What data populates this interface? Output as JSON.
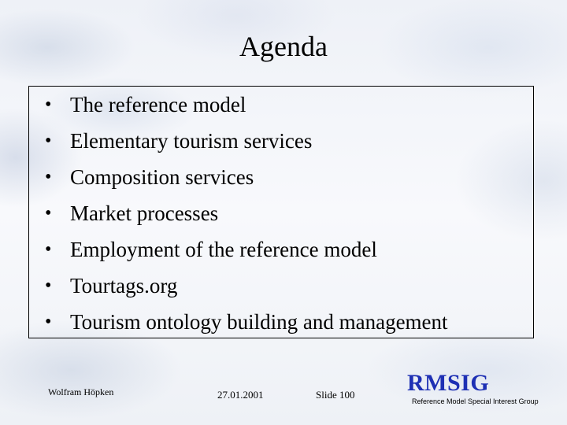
{
  "slide": {
    "title": "Agenda",
    "items": [
      {
        "bullet": "•",
        "text": "The reference model"
      },
      {
        "bullet": "•",
        "text": "Elementary tourism services"
      },
      {
        "bullet": "•",
        "text": "Composition services"
      },
      {
        "bullet": "•",
        "text": "Market processes"
      },
      {
        "bullet": "•",
        "text": "Employment of the reference model"
      },
      {
        "bullet": "•",
        "text": "Tourtags.org"
      },
      {
        "bullet": "•",
        "text": "Tourism ontology building and management"
      }
    ]
  },
  "footer": {
    "author": "Wolfram Höpken",
    "date": "27.01.2001",
    "slide_number": "Slide 100"
  },
  "logo": {
    "name": "RMSIG",
    "tagline": "Reference Model Special Interest Group",
    "color": "#1e30b4"
  }
}
